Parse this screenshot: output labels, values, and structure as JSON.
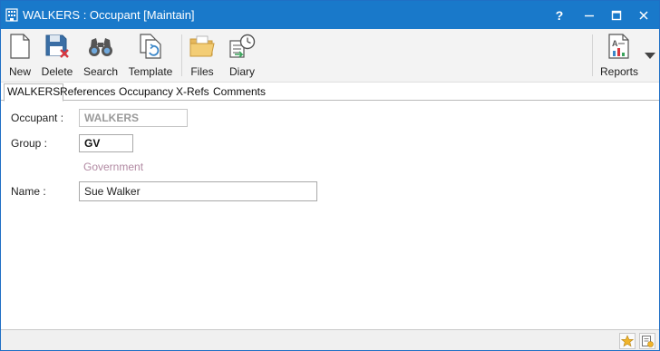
{
  "window": {
    "title": "WALKERS : Occupant [Maintain]",
    "controls": {
      "help": "?",
      "minimize": "—",
      "maximize": "□",
      "close": "✕"
    }
  },
  "ribbon": {
    "buttons": [
      {
        "label": "New",
        "icon": "new-document-icon"
      },
      {
        "label": "Delete",
        "icon": "delete-save-icon"
      },
      {
        "label": "Search",
        "icon": "binoculars-icon"
      },
      {
        "label": "Template",
        "icon": "template-icon"
      },
      {
        "label": "Files",
        "icon": "folder-icon"
      },
      {
        "label": "Diary",
        "icon": "diary-clock-icon"
      },
      {
        "label": "Reports",
        "icon": "report-icon"
      }
    ]
  },
  "tabs": [
    "WALKERS",
    "References",
    "Occupancy",
    "X-Refs",
    "Comments"
  ],
  "form": {
    "occupant": {
      "label": "Occupant :",
      "value": "WALKERS"
    },
    "group": {
      "label": "Group :",
      "value": "GV",
      "description": "Government"
    },
    "name": {
      "label": "Name :",
      "value": "Sue Walker"
    }
  },
  "colors": {
    "titlebar": "#1979ca",
    "description": "#b28aa3",
    "accent": "#f0b429"
  }
}
